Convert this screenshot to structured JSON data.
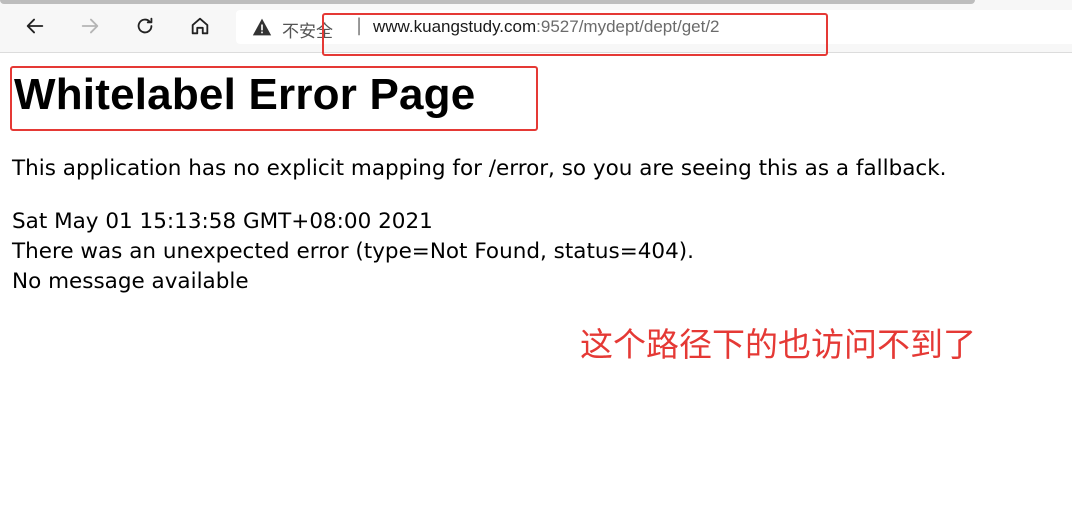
{
  "browser": {
    "security_label": "不安全",
    "separator": "|",
    "url_host": "www.kuangstudy.com",
    "url_path": ":9527/mydept/dept/get/2"
  },
  "page": {
    "title": "Whitelabel Error Page",
    "description": "This application has no explicit mapping for /error, so you are seeing this as a fallback.",
    "timestamp": "Sat May 01 15:13:58 GMT+08:00 2021",
    "error_line": "There was an unexpected error (type=Not Found, status=404).",
    "message": "No message available"
  },
  "annotation": {
    "text": "这个路径下的也访问不到了",
    "color": "#e53935"
  },
  "icons": {
    "back": "back-arrow-icon",
    "forward": "forward-arrow-icon",
    "refresh": "refresh-icon",
    "home": "home-icon",
    "warning": "warning-triangle-icon"
  }
}
